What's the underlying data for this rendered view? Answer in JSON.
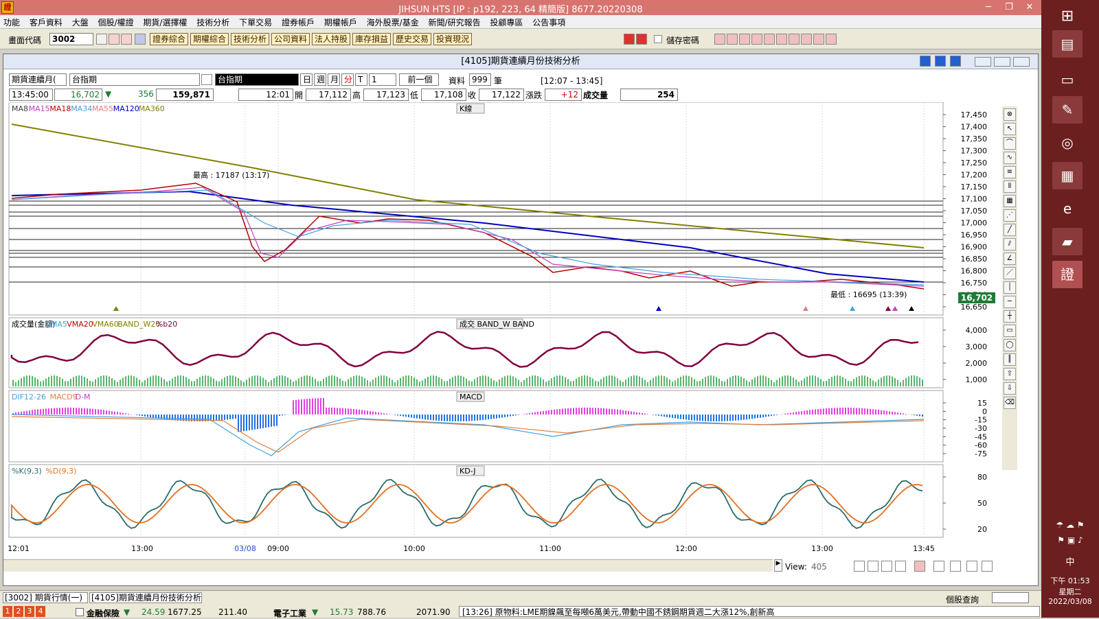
{
  "app": {
    "title": "JIHSUN HTS     [IP : p192, 223, 64 精簡版] 8677.20220308",
    "logo": "證"
  },
  "menu": [
    "功能",
    "客戶資料",
    "大盤",
    "個股/權證",
    "期貨/選擇權",
    "技術分析",
    "下單交易",
    "證券帳戶",
    "期權帳戶",
    "海外股票/基金",
    "新聞/研究報告",
    "投顧專區",
    "公告事項"
  ],
  "toolbar": {
    "code_label": "畫面代碼",
    "code_value": "3002",
    "buttons": [
      "證券綜合",
      "期權綜合",
      "技術分析",
      "公司資料",
      "法人持股",
      "庫存損益",
      "歷史交易",
      "投資現況"
    ],
    "save_pwd_label": "儲存密碼"
  },
  "window": {
    "title": "[4105]期貨連續月份技術分析",
    "product_select": "期貨連續月(",
    "product_name": "台指期",
    "index_label": "台指期",
    "period_buttons": [
      "日",
      "週",
      "月",
      "分",
      "T"
    ],
    "interval_value": "1",
    "prev_label": "前一個",
    "data_label": "資料",
    "data_count": "999",
    "data_unit": "筆",
    "range_label": "[12:07 - 13:45]"
  },
  "quote": {
    "time": "13:45:00",
    "price": "16,702",
    "change": "356",
    "volume": "159,871",
    "bar_time": "12:01",
    "open_label": "開",
    "open": "17,112",
    "high_label": "高",
    "high": "17,123",
    "low_label": "低",
    "low": "17,108",
    "close_label": "收",
    "close": "17,122",
    "chg_label": "漲跌",
    "chg": "+12",
    "vol_label": "成交量",
    "vol": "254"
  },
  "panels": {
    "k": {
      "title": "K線",
      "legend": [
        "MA8",
        "MA15",
        "MA18",
        "MA34",
        "MA55",
        "MA120",
        "MA360"
      ],
      "legend_colors": [
        "#404040",
        "#c040c0",
        "#c00000",
        "#40a0e0",
        "#e08080",
        "#0000c0",
        "#808000"
      ],
      "annot_high": "最高 : 17187 (13:17)",
      "annot_low": "最低 : 16695 (13:39)",
      "price_tag": "16,702",
      "y_ticks": [
        "17,450",
        "17,400",
        "17,350",
        "17,300",
        "17,250",
        "17,200",
        "17,150",
        "17,100",
        "17,050",
        "17,000",
        "16,950",
        "16,900",
        "16,850",
        "16,800",
        "16,750",
        "16,700",
        "16,650"
      ]
    },
    "vol": {
      "title": "成交  BAND_W  BAND",
      "legend": [
        "成交量(金額)",
        "VMA5",
        "VMA20",
        "VMA60",
        "BAND_W20",
        "%b20"
      ],
      "legend_colors": [
        "#000000",
        "#40a0e0",
        "#c00000",
        "#808000",
        "#808000",
        "#800040"
      ],
      "y_ticks": [
        "4,000",
        "3,000",
        "2,000",
        "1,000"
      ]
    },
    "macd": {
      "title": "MACD",
      "legend": [
        "DIF12-26",
        "MACD9",
        "D-M"
      ],
      "legend_colors": [
        "#40a0e0",
        "#e08040",
        "#c040c0"
      ],
      "y_ticks": [
        "15",
        "0",
        "-15",
        "-30",
        "-45",
        "-60",
        "-75"
      ]
    },
    "kd": {
      "title": "KD-J",
      "legend": [
        "%K(9,3)",
        "%D(9,3)"
      ],
      "legend_colors": [
        "#2a6a6a",
        "#e07020"
      ],
      "y_ticks": [
        "80",
        "50",
        "20"
      ]
    },
    "x_ticks": [
      "12:01",
      "13:00",
      "03/08",
      "09:00",
      "10:00",
      "11:00",
      "12:00",
      "13:00",
      "13:45"
    ]
  },
  "view": {
    "label": "View:",
    "value": "405"
  },
  "status": {
    "tab1": "[3002] 期貨行情(一)",
    "tab2": "[4105]期貨連續月份技術分析",
    "lookup_label": "個股查詢",
    "nums": [
      "1",
      "2",
      "3",
      "4"
    ],
    "ticker1": {
      "name": "金融保險",
      "chg": "24.59",
      "val": "1677.25",
      "amt": "211.40"
    },
    "ticker2": {
      "name": "電子工業",
      "chg": "15.73",
      "val": "788.76",
      "amt": "2071.90"
    },
    "news": "[13:26] 原物料:LME期鎳飆至每噸6萬美元,帶動中國不銹鋼期貨週二大漲12%,創新高"
  },
  "taskbar": {
    "time": "下午 01:53",
    "weekday": "星期二",
    "date": "2022/03/08",
    "ime": "中"
  }
}
